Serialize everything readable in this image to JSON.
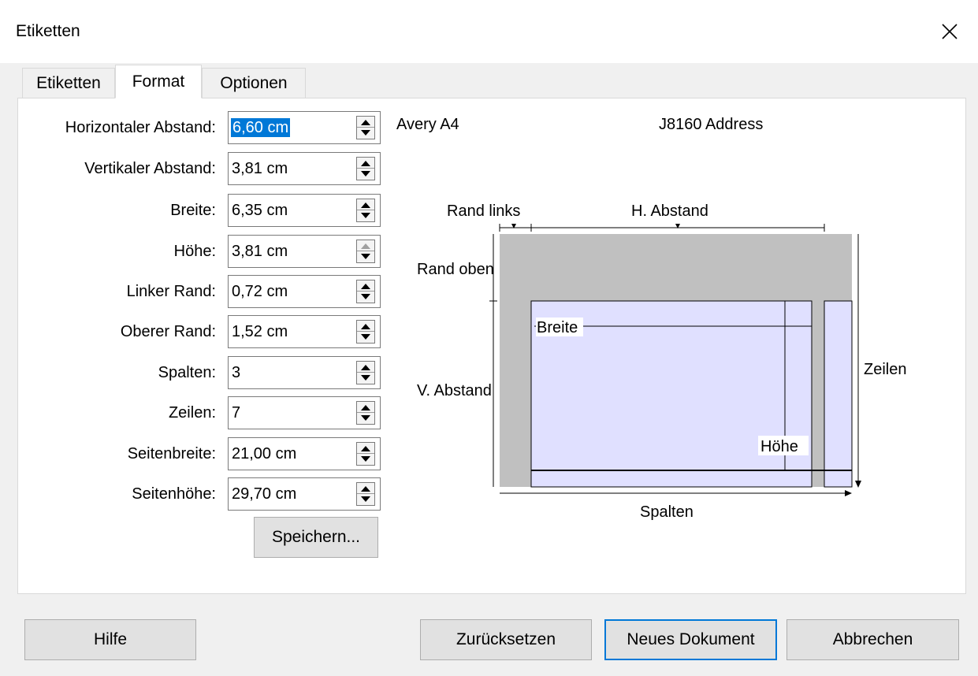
{
  "window": {
    "title": "Etiketten"
  },
  "tabs": [
    {
      "label": "Etiketten",
      "active": false
    },
    {
      "label": "Format",
      "active": true
    },
    {
      "label": "Optionen",
      "active": false
    }
  ],
  "fields": [
    {
      "label": "Horizontaler Abstand:",
      "value": "6,60 cm",
      "selected": true
    },
    {
      "label": "Vertikaler Abstand:",
      "value": "3,81 cm"
    },
    {
      "label": "Breite:",
      "value": "6,35 cm"
    },
    {
      "label": "Höhe:",
      "value": "3,81 cm",
      "up_disabled": true
    },
    {
      "label": "Linker Rand:",
      "value": "0,72 cm"
    },
    {
      "label": "Oberer Rand:",
      "value": "1,52 cm"
    },
    {
      "label": "Spalten:",
      "value": "3"
    },
    {
      "label": "Zeilen:",
      "value": "7"
    },
    {
      "label": "Seitenbreite:",
      "value": "21,00 cm"
    },
    {
      "label": "Seitenhöhe:",
      "value": "29,70 cm"
    }
  ],
  "save_button": "Speichern...",
  "label_info": {
    "brand": "Avery A4",
    "type": "J8160 Address"
  },
  "preview": {
    "rand_links": "Rand links",
    "h_abstand": "H. Abstand",
    "rand_oben": "Rand oben",
    "v_abstand": "V. Abstand",
    "breite": "Breite",
    "hoehe": "Höhe",
    "zeilen": "Zeilen",
    "spalten": "Spalten",
    "colors": {
      "page": "#c0c0c0",
      "label": "#e0e0ff",
      "line": "#000000"
    }
  },
  "buttons": {
    "help": "Hilfe",
    "reset": "Zurücksetzen",
    "new_document": "Neues Dokument",
    "cancel": "Abbrechen"
  }
}
